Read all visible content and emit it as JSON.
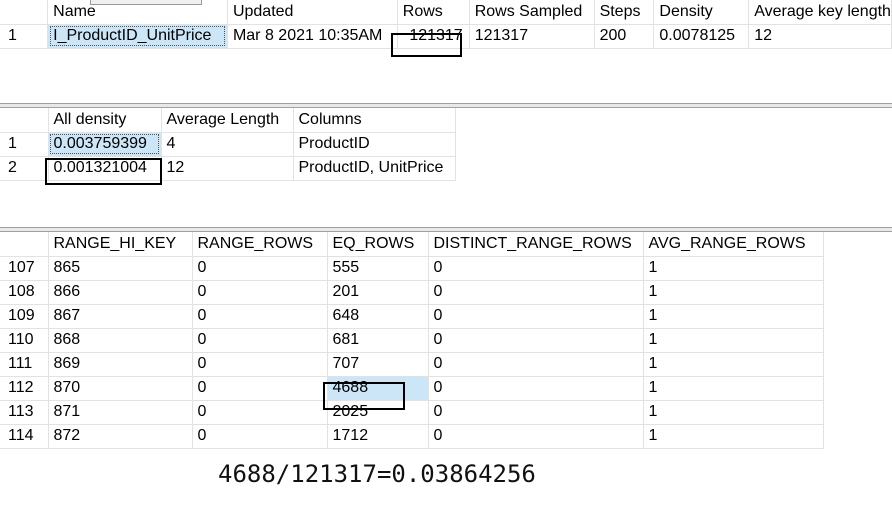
{
  "stats_header": {
    "columns": [
      "Name",
      "Updated",
      "Rows",
      "Rows Sampled",
      "Steps",
      "Density",
      "Average key length"
    ],
    "rows": [
      {
        "rownum": "1",
        "cells": [
          "I_ProductID_UnitPrice",
          "Mar  8 2021 10:35AM",
          "121317",
          "121317",
          "200",
          "0.0078125",
          "12"
        ]
      }
    ]
  },
  "density_vector": {
    "columns": [
      "All density",
      "Average Length",
      "Columns"
    ],
    "rows": [
      {
        "rownum": "1",
        "cells": [
          "0.003759399",
          "4",
          "ProductID"
        ]
      },
      {
        "rownum": "2",
        "cells": [
          "0.001321004",
          "12",
          "ProductID, UnitPrice"
        ]
      }
    ]
  },
  "histogram": {
    "columns": [
      "RANGE_HI_KEY",
      "RANGE_ROWS",
      "EQ_ROWS",
      "DISTINCT_RANGE_ROWS",
      "AVG_RANGE_ROWS"
    ],
    "rows": [
      {
        "rownum": "107",
        "cells": [
          "865",
          "0",
          "555",
          "0",
          "1"
        ]
      },
      {
        "rownum": "108",
        "cells": [
          "866",
          "0",
          "201",
          "0",
          "1"
        ]
      },
      {
        "rownum": "109",
        "cells": [
          "867",
          "0",
          "648",
          "0",
          "1"
        ]
      },
      {
        "rownum": "110",
        "cells": [
          "868",
          "0",
          "681",
          "0",
          "1"
        ]
      },
      {
        "rownum": "111",
        "cells": [
          "869",
          "0",
          "707",
          "0",
          "1"
        ]
      },
      {
        "rownum": "112",
        "cells": [
          "870",
          "0",
          "4688",
          "0",
          "1"
        ]
      },
      {
        "rownum": "113",
        "cells": [
          "871",
          "0",
          "2025",
          "0",
          "1"
        ]
      },
      {
        "rownum": "114",
        "cells": [
          "872",
          "0",
          "1712",
          "0",
          "1"
        ]
      }
    ]
  },
  "annotation": {
    "formula": "4688/121317=0.03864256"
  }
}
